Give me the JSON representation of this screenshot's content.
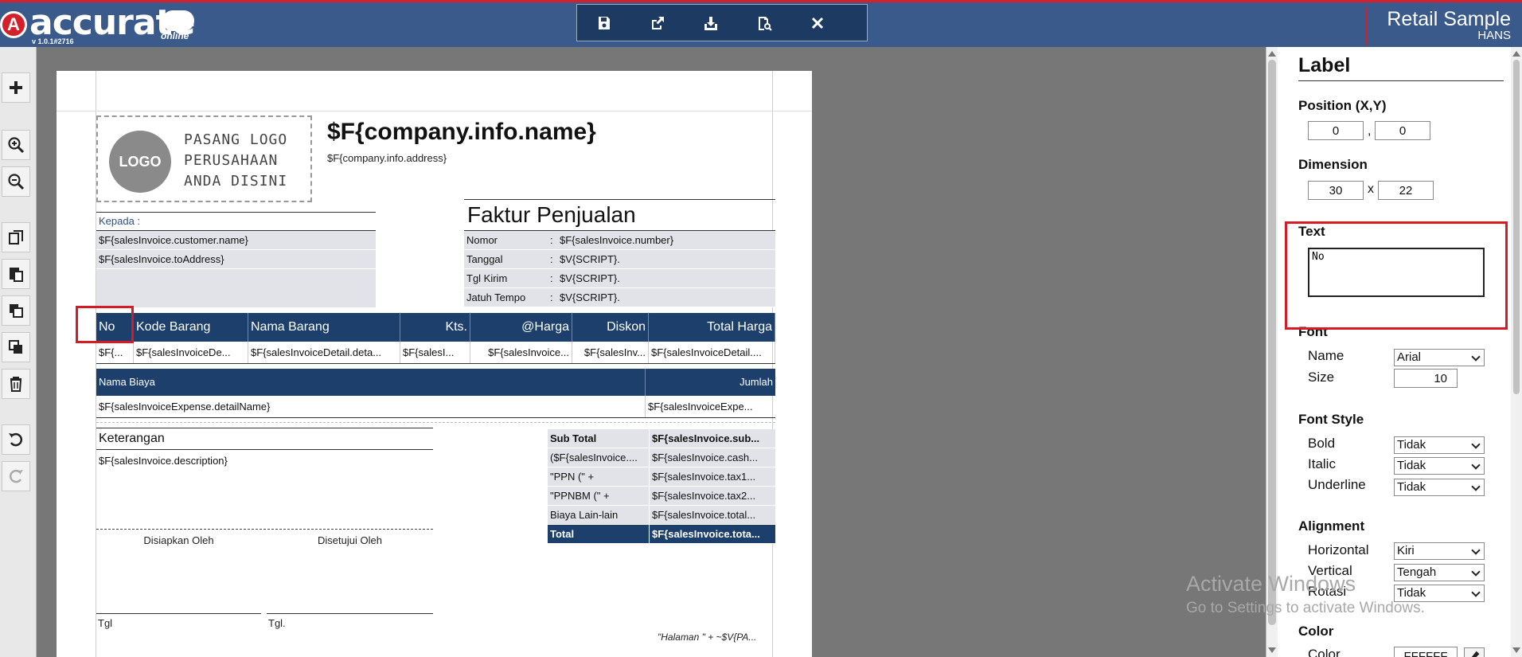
{
  "header": {
    "app_name": "accurate",
    "app_online": "online",
    "app_version": "v 1.0.1#2716",
    "company_name": "Retail Sample",
    "user": "HANS",
    "colors": {
      "bar": "#3a5a8c",
      "accent": "#d4202a",
      "toolbar": "#1d3a63"
    },
    "toolbar_icons": [
      "save-icon",
      "export-icon",
      "import-icon",
      "preview-icon",
      "close-icon"
    ]
  },
  "left_tools": [
    "add-icon",
    "zoom-in-icon",
    "zoom-out-icon",
    "copy-icon",
    "paste-icon",
    "bring-front-icon",
    "send-back-icon",
    "delete-icon",
    "undo-icon",
    "redo-icon"
  ],
  "report": {
    "logo_label": "LOGO",
    "logo_caption": [
      "PASANG LOGO",
      "PERUSAHAAN",
      "ANDA DISINI"
    ],
    "company_name": "$F{company.info.name}",
    "company_address": "$F{company.info.address}",
    "kepada": {
      "label": "Kepada :",
      "rows": [
        "$F{salesInvoice.customer.name}",
        "$F{salesInvoice.toAddress}"
      ]
    },
    "faktur": {
      "title": "Faktur Penjualan",
      "rows": [
        {
          "label": "Nomor",
          "colon": ":",
          "value": "$F{salesInvoice.number}"
        },
        {
          "label": "Tanggal",
          "colon": ":",
          "value": "$V{SCRIPT}."
        },
        {
          "label": "Tgl Kirim",
          "colon": ":",
          "value": "$V{SCRIPT}."
        },
        {
          "label": "Jatuh Tempo",
          "colon": ":",
          "value": "$V{SCRIPT}."
        }
      ]
    },
    "items": {
      "headers": [
        "No",
        "Kode Barang",
        "Nama Barang",
        "Kts.",
        "@Harga",
        "Diskon",
        "Total Harga"
      ],
      "row": [
        "$F{...",
        "$F{salesInvoiceDe...",
        "$F{salesInvoiceDetail.deta...",
        "$F{salesI...",
        "$F{salesInvoice...",
        "$F{salesInv...",
        "$F{salesInvoiceDetail...."
      ]
    },
    "biaya": {
      "headers": [
        "Nama Biaya",
        "Jumlah"
      ],
      "row": [
        "$F{salesInvoiceExpense.detailName}",
        "$F{salesInvoiceExpe..."
      ]
    },
    "keterangan": {
      "label": "Keterangan",
      "value": "$F{salesInvoice.description}"
    },
    "signatures": {
      "prepared": "Disiapkan Oleh",
      "approved": "Disetujui Oleh",
      "tgl1": "Tgl",
      "tgl2": "Tgl."
    },
    "totals": [
      {
        "label": "Sub Total",
        "value": "$F{salesInvoice.sub...",
        "style": "bold"
      },
      {
        "label": "($F{salesInvoice....",
        "value": "$F{salesInvoice.cash...",
        "style": "normal"
      },
      {
        "label": "\"PPN (\" +",
        "value": "$F{salesInvoice.tax1...",
        "style": "normal"
      },
      {
        "label": "\"PPNBM (\" +",
        "value": "$F{salesInvoice.tax2...",
        "style": "normal"
      },
      {
        "label": "Biaya Lain-lain",
        "value": "$F{salesInvoice.total...",
        "style": "normal"
      },
      {
        "label": "Total",
        "value": "$F{salesInvoice.tota...",
        "style": "dark"
      }
    ],
    "footer": "\"Halaman \" +  ~$V{PA..."
  },
  "panel": {
    "title": "Label",
    "position": {
      "label": "Position (X,Y)",
      "x": "0",
      "y": "0",
      "sep": ","
    },
    "dimension": {
      "label": "Dimension",
      "w": "30",
      "h": "22",
      "sep": "x"
    },
    "text": {
      "label": "Text",
      "value": "No"
    },
    "font": {
      "label": "Font",
      "name_label": "Name",
      "name": "Arial",
      "size_label": "Size",
      "size": "10"
    },
    "font_style": {
      "label": "Font Style",
      "bold_label": "Bold",
      "bold": "Tidak",
      "italic_label": "Italic",
      "italic": "Tidak",
      "underline_label": "Underline",
      "underline": "Tidak"
    },
    "alignment": {
      "label": "Alignment",
      "h_label": "Horizontal",
      "h": "Kiri",
      "v_label": "Vertical",
      "v": "Tengah",
      "r_label": "Rotasi",
      "r": "Tidak"
    },
    "color": {
      "label": "Color",
      "sub_label": "Color",
      "value": "FFFFFF"
    }
  },
  "watermark": {
    "line1": "Activate Windows",
    "line2": "Go to Settings to activate Windows."
  }
}
